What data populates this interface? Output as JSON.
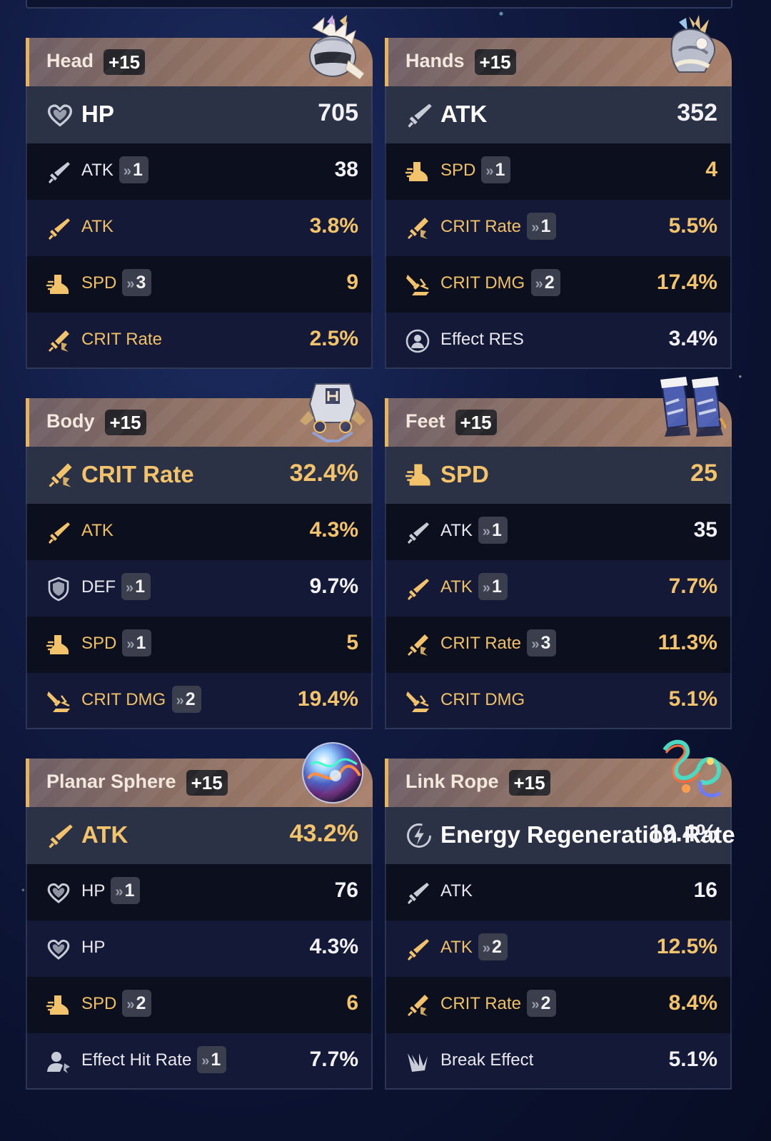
{
  "colors": {
    "gold": "#f3c36b",
    "white": "#f2f2f6",
    "badge_bg": "#3b3f4d",
    "header_accent": "#e7b45c"
  },
  "relics": [
    {
      "slot": "Head",
      "level": "+15",
      "icon": "helmet-relic-icon",
      "main": {
        "name": "HP",
        "value": "705",
        "icon": "heart-icon",
        "highlight": false
      },
      "subs": [
        {
          "name": "ATK",
          "roll": "1",
          "value": "38",
          "icon": "sword-icon",
          "highlight": false
        },
        {
          "name": "ATK",
          "roll": "",
          "value": "3.8%",
          "icon": "sword-icon",
          "highlight": true
        },
        {
          "name": "SPD",
          "roll": "3",
          "value": "9",
          "icon": "boot-icon",
          "highlight": true
        },
        {
          "name": "CRIT Rate",
          "roll": "",
          "value": "2.5%",
          "icon": "crit-rate-icon",
          "highlight": true
        }
      ]
    },
    {
      "slot": "Hands",
      "level": "+15",
      "icon": "gauntlet-relic-icon",
      "main": {
        "name": "ATK",
        "value": "352",
        "icon": "sword-icon",
        "highlight": false
      },
      "subs": [
        {
          "name": "SPD",
          "roll": "1",
          "value": "4",
          "icon": "boot-icon",
          "highlight": true
        },
        {
          "name": "CRIT Rate",
          "roll": "1",
          "value": "5.5%",
          "icon": "crit-rate-icon",
          "highlight": true
        },
        {
          "name": "CRIT DMG",
          "roll": "2",
          "value": "17.4%",
          "icon": "crit-dmg-icon",
          "highlight": true
        },
        {
          "name": "Effect RES",
          "roll": "",
          "value": "3.4%",
          "icon": "effect-res-icon",
          "highlight": false
        }
      ]
    },
    {
      "slot": "Body",
      "level": "+15",
      "icon": "armor-relic-icon",
      "main": {
        "name": "CRIT Rate",
        "value": "32.4%",
        "icon": "crit-rate-icon",
        "highlight": true
      },
      "subs": [
        {
          "name": "ATK",
          "roll": "",
          "value": "4.3%",
          "icon": "sword-icon",
          "highlight": true
        },
        {
          "name": "DEF",
          "roll": "1",
          "value": "9.7%",
          "icon": "shield-icon",
          "highlight": false
        },
        {
          "name": "SPD",
          "roll": "1",
          "value": "5",
          "icon": "boot-icon",
          "highlight": true
        },
        {
          "name": "CRIT DMG",
          "roll": "2",
          "value": "19.4%",
          "icon": "crit-dmg-icon",
          "highlight": true
        }
      ]
    },
    {
      "slot": "Feet",
      "level": "+15",
      "icon": "boots-relic-icon",
      "main": {
        "name": "SPD",
        "value": "25",
        "icon": "boot-icon",
        "highlight": true
      },
      "subs": [
        {
          "name": "ATK",
          "roll": "1",
          "value": "35",
          "icon": "sword-icon",
          "highlight": false
        },
        {
          "name": "ATK",
          "roll": "1",
          "value": "7.7%",
          "icon": "sword-icon",
          "highlight": true
        },
        {
          "name": "CRIT Rate",
          "roll": "3",
          "value": "11.3%",
          "icon": "crit-rate-icon",
          "highlight": true
        },
        {
          "name": "CRIT DMG",
          "roll": "",
          "value": "5.1%",
          "icon": "crit-dmg-icon",
          "highlight": true
        }
      ]
    },
    {
      "slot": "Planar Sphere",
      "level": "+15",
      "icon": "sphere-relic-icon",
      "main": {
        "name": "ATK",
        "value": "43.2%",
        "icon": "sword-icon",
        "highlight": true
      },
      "subs": [
        {
          "name": "HP",
          "roll": "1",
          "value": "76",
          "icon": "heart-icon",
          "highlight": false
        },
        {
          "name": "HP",
          "roll": "",
          "value": "4.3%",
          "icon": "heart-icon",
          "highlight": false
        },
        {
          "name": "SPD",
          "roll": "2",
          "value": "6",
          "icon": "boot-icon",
          "highlight": true
        },
        {
          "name": "Effect Hit Rate",
          "roll": "1",
          "value": "7.7%",
          "icon": "effect-hit-icon",
          "highlight": false
        }
      ]
    },
    {
      "slot": "Link Rope",
      "level": "+15",
      "icon": "rope-relic-icon",
      "main": {
        "name": "Energy Regeneration Rate",
        "value": "19.4%",
        "icon": "energy-regen-icon",
        "highlight": false
      },
      "subs": [
        {
          "name": "ATK",
          "roll": "",
          "value": "16",
          "icon": "sword-icon",
          "highlight": false
        },
        {
          "name": "ATK",
          "roll": "2",
          "value": "12.5%",
          "icon": "sword-icon",
          "highlight": true
        },
        {
          "name": "CRIT Rate",
          "roll": "2",
          "value": "8.4%",
          "icon": "crit-rate-icon",
          "highlight": true
        },
        {
          "name": "Break Effect",
          "roll": "",
          "value": "5.1%",
          "icon": "break-effect-icon",
          "highlight": false
        }
      ]
    }
  ]
}
